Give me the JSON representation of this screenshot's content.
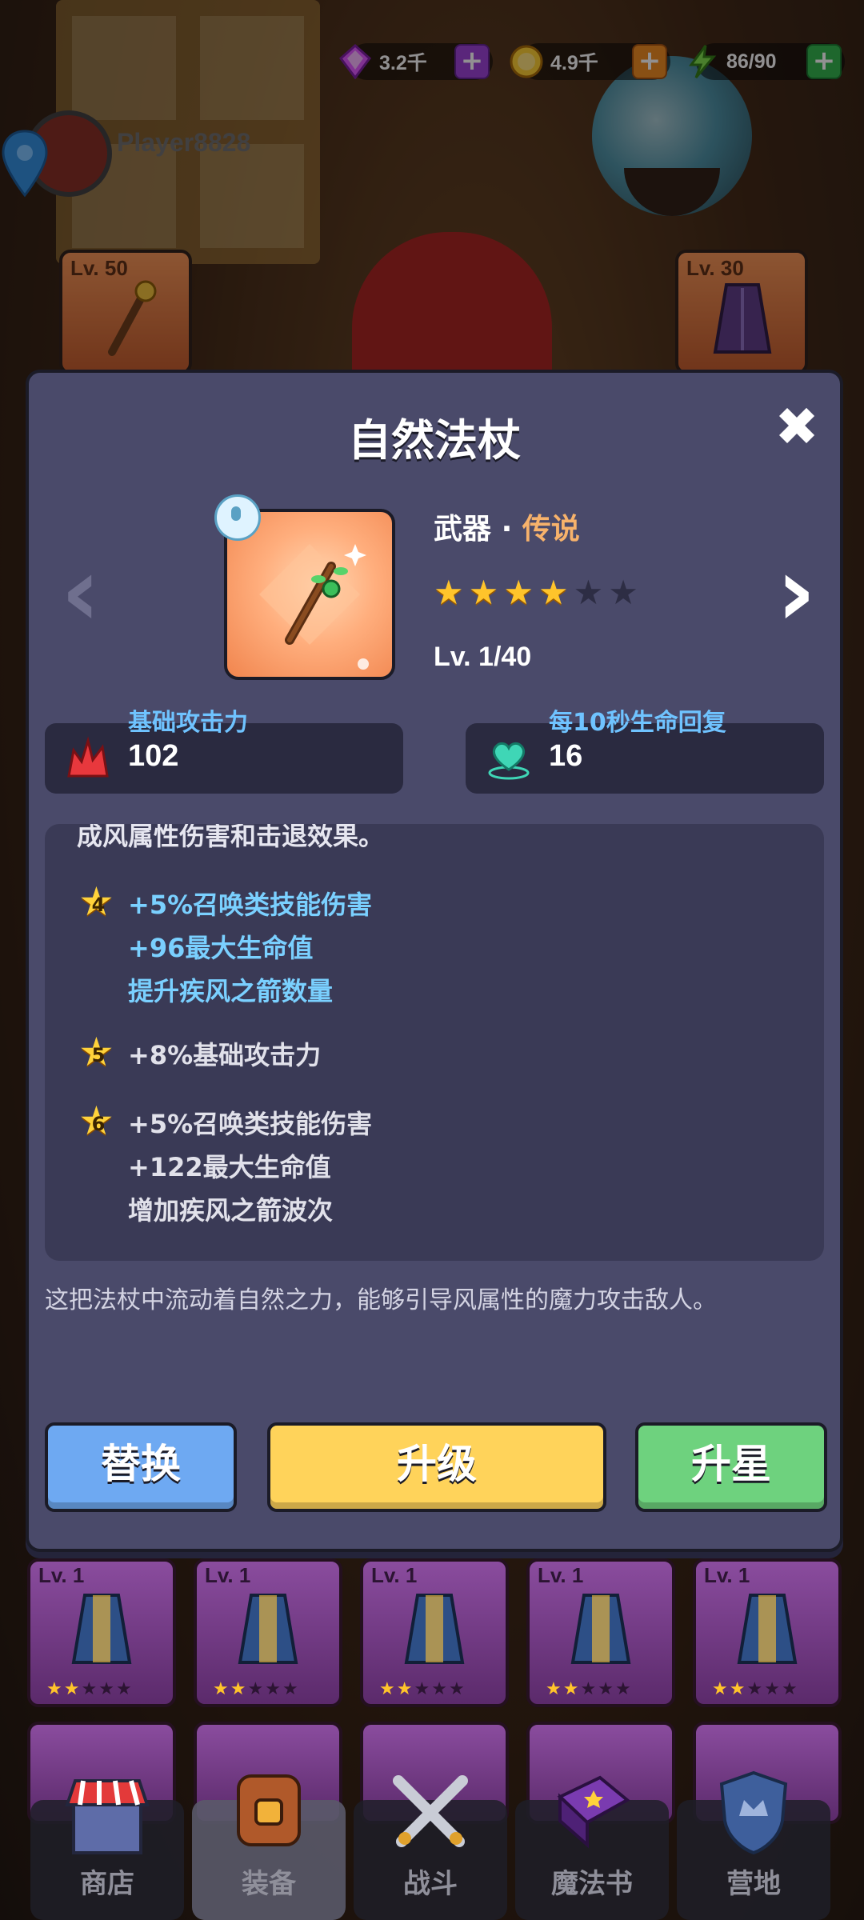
{
  "resources": [
    {
      "icon": "gem-icon",
      "value": "3.2千",
      "plus": "+"
    },
    {
      "icon": "gold-coin-icon",
      "value": "4.9千",
      "plus": "+"
    },
    {
      "icon": "energy-bolt-icon",
      "value": "86/90",
      "plus": "+"
    }
  ],
  "player": {
    "name": "Player8828"
  },
  "background_equipment": [
    {
      "level": "Lv. 50"
    },
    {
      "level": "Lv. 30"
    }
  ],
  "item": {
    "name": "自然法杖",
    "category": "武器",
    "separator": "·",
    "rarity": "传说",
    "stars_filled": 4,
    "stars_total": 6,
    "level": "Lv. 1/40",
    "stats": [
      {
        "label": "基础攻击力",
        "value": "102"
      },
      {
        "label": "每10秒生命回复",
        "value": "16"
      }
    ],
    "effects_cut_line": "成风属性伤害和击退效果。",
    "effects": [
      {
        "star": "4",
        "lines": [
          "+5%召唤类技能伤害",
          "+96最大生命值",
          "提升疾风之箭数量"
        ]
      },
      {
        "star": "5",
        "lines": [
          "+8%基础攻击力"
        ]
      },
      {
        "star": "6",
        "lines": [
          "+5%召唤类技能伤害",
          "+122最大生命值",
          "增加疾风之箭波次"
        ]
      }
    ],
    "description": "这把法杖中流动着自然之力，能够引导风属性的魔力攻击敌人。"
  },
  "buttons": {
    "replace": "替换",
    "upgrade": "升级",
    "star_up": "升星"
  },
  "close_symbol": "✖",
  "nav_arrows": {
    "left": "‹",
    "right": "›"
  },
  "inventory": [
    {
      "level": "Lv. 1",
      "stars": 2
    },
    {
      "level": "Lv. 1",
      "stars": 2
    },
    {
      "level": "Lv. 1",
      "stars": 2
    },
    {
      "level": "Lv. 1",
      "stars": 2
    },
    {
      "level": "Lv. 1",
      "stars": 2
    }
  ],
  "bottom_nav": [
    {
      "label": "商店",
      "icon": "shop-icon"
    },
    {
      "label": "装备",
      "icon": "backpack-icon",
      "active": true
    },
    {
      "label": "战斗",
      "icon": "crossed-swords-icon"
    },
    {
      "label": "魔法书",
      "icon": "spellbook-icon"
    },
    {
      "label": "营地",
      "icon": "camp-shield-icon"
    }
  ],
  "colors": {
    "rarity": "#f7b26b",
    "effect_blue": "#7ad0ff",
    "btn_blue": "#6ea9f2",
    "btn_yellow": "#ffd35a",
    "btn_green": "#6ed27e"
  }
}
